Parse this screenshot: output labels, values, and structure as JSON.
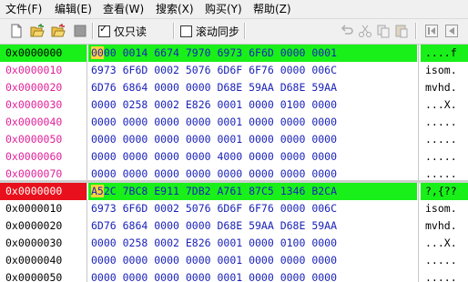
{
  "menu": [
    {
      "label": "文件(F)"
    },
    {
      "label": "编辑(E)"
    },
    {
      "label": "查看(W)"
    },
    {
      "label": "搜索(X)"
    },
    {
      "label": "购买(Y)"
    },
    {
      "label": "帮助(Z)"
    }
  ],
  "toolbar": {
    "readonly_label": "仅只读",
    "readonly_checked": true,
    "sync_label": "滚动同步",
    "sync_checked": false
  },
  "colors": {
    "offset_pink": "#e0209a",
    "offset_black": "#000000",
    "hex_blue": "#1a22b8",
    "highlight_green": "#19f019",
    "highlight_red": "#e8101c",
    "cursor_yellow": "#ffd23d"
  },
  "panes": [
    {
      "rows": [
        {
          "offset": "0x0000000",
          "hex": "0000 0014 6674 7970 6973 6F6D 0000 0001",
          "ascii": "....f",
          "highlight": true,
          "cursor": "00"
        },
        {
          "offset": "0x0000010",
          "hex": "6973 6F6D 0002 5076 6D6F 6F76 0000 006C",
          "ascii": "isom."
        },
        {
          "offset": "0x0000020",
          "hex": "6D76 6864 0000 0000 D68E 59AA D68E 59AA",
          "ascii": "mvhd."
        },
        {
          "offset": "0x0000030",
          "hex": "0000 0258 0002 E826 0001 0000 0100 0000",
          "ascii": "...X."
        },
        {
          "offset": "0x0000040",
          "hex": "0000 0000 0000 0000 0001 0000 0000 0000",
          "ascii": "....."
        },
        {
          "offset": "0x0000050",
          "hex": "0000 0000 0000 0000 0001 0000 0000 0000",
          "ascii": "....."
        },
        {
          "offset": "0x0000060",
          "hex": "0000 0000 0000 0000 4000 0000 0000 0000",
          "ascii": "....."
        },
        {
          "offset": "0x0000070",
          "hex": "0000 0000 0000 0000 0000 0000 0000 0000",
          "ascii": "....."
        }
      ]
    },
    {
      "rows": [
        {
          "offset": "0x0000000",
          "hex": "A52C 7BC8 E911 7DB2 A761 87C5 1346 B2CA",
          "ascii": "?,{??",
          "highlight": true,
          "cursor": "A5"
        },
        {
          "offset": "0x0000010",
          "hex": "6973 6F6D 0002 5076 6D6F 6F76 0000 006C",
          "ascii": "isom."
        },
        {
          "offset": "0x0000020",
          "hex": "6D76 6864 0000 0000 D68E 59AA D68E 59AA",
          "ascii": "mvhd."
        },
        {
          "offset": "0x0000030",
          "hex": "0000 0258 0002 E826 0001 0000 0100 0000",
          "ascii": "...X."
        },
        {
          "offset": "0x0000040",
          "hex": "0000 0000 0000 0000 0001 0000 0000 0000",
          "ascii": "....."
        },
        {
          "offset": "0x0000050",
          "hex": "0000 0000 0000 0000 0001 0000 0000 0000",
          "ascii": "....."
        }
      ]
    }
  ]
}
